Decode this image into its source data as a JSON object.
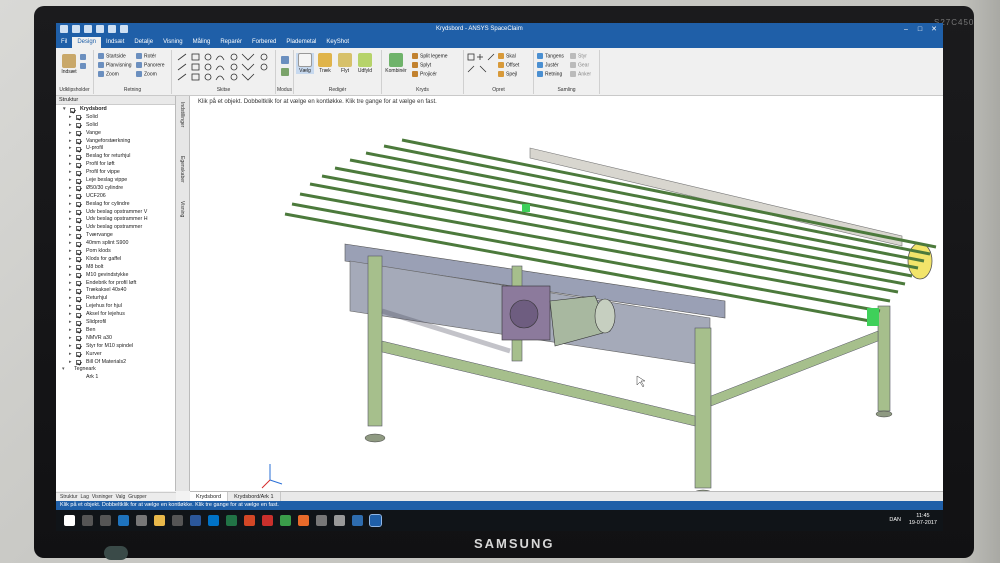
{
  "app": {
    "title": "Krydsbord - ANSYS SpaceClaim",
    "window_controls": [
      "–",
      "□",
      "✕"
    ]
  },
  "ribbon_tabs": [
    "Fil",
    "Design",
    "Indsæt",
    "Detalje",
    "Visning",
    "Måling",
    "Reparér",
    "Forbered",
    "Plademetal",
    "KeyShot"
  ],
  "active_tab": "Design",
  "ribbon": {
    "clipboard": {
      "name": "Udklipsholder",
      "paste": "Indsæt"
    },
    "orient": {
      "name": "Retning",
      "items": [
        "Startside",
        "Planvisning",
        "Zoom",
        "Rotér",
        "Panorere",
        "Zoom"
      ]
    },
    "sketch": {
      "name": "Skitse"
    },
    "mode": {
      "name": "Modus"
    },
    "edit": {
      "name": "Redigér",
      "buttons": [
        "Vælg",
        "Træk",
        "Flyt",
        "Udfyld"
      ]
    },
    "intersect": {
      "name": "Kryds",
      "items": [
        "Kombinér",
        "Split legeme",
        "Splyt",
        "Projicér"
      ]
    },
    "create": {
      "name": "Opret",
      "items": [
        "Skal",
        "Offset",
        "Spejl"
      ]
    },
    "assembly": {
      "name": "Samling",
      "items": [
        "Tangens",
        "Justér",
        "Retning",
        "Styr",
        "Gear",
        "Anker"
      ]
    }
  },
  "panel": {
    "title": "Struktur",
    "root": "Krydsbord",
    "items": [
      "Solid",
      "Solid",
      "Vange",
      "Vangeforstærkning",
      "U-profil",
      "Beslag for returhjul",
      "Profil for løft",
      "Profil for vippe",
      "Leje beslag vippe",
      "Ø50/30 cylindre",
      "UCF206",
      "Beslag for cylindre",
      "Udv beslag opstrammer V",
      "Udv beslag opstrammer H",
      "Udv beslag opstrammer",
      "Tværvange",
      "40mm splint S900",
      "Pom klods",
      "Klods for gaffel",
      "M8 bolt",
      "M10 gevindstykke",
      "Endebrik for profil løft",
      "Trækaksel 40x40",
      "Returhjul",
      "Lejehus for hjul",
      "Aksel for lejehus",
      "Slidprofil",
      "Ben",
      "NMVR a30",
      "Styr for M10 spindel",
      "Kurver",
      "Bill Of Materials2"
    ],
    "sheets_root": "Tegneark",
    "sheets": [
      "Ark 1"
    ],
    "bottom_tabs": [
      "Struktur",
      "Lag",
      "Visninger",
      "Valg",
      "Grupper"
    ]
  },
  "side_tabs": [
    "Indstillinger",
    "Egenskaber",
    "Visning"
  ],
  "viewport": {
    "hint": "Klik på et objekt. Dobbeltklik for at vælge en kontløkke. Klik tre gange for at vælge en fast."
  },
  "doc_tabs": [
    "Krydsbord",
    "Krydsbord/Ark 1"
  ],
  "status": "Klik på et objekt. Dobbeltklik for at vælge en kontløkke. Klik tre gange for at vælge en fast.",
  "taskbar": {
    "lang": "DAN",
    "time": "11:45",
    "date": "19-07-2017"
  },
  "monitor": {
    "brand": "SAMSUNG",
    "model": "S27C450"
  },
  "colors": {
    "accent": "#1f5fa8",
    "frame": "#9db58a",
    "rails": "#6f9f5c",
    "beam": "#8d93a8"
  }
}
